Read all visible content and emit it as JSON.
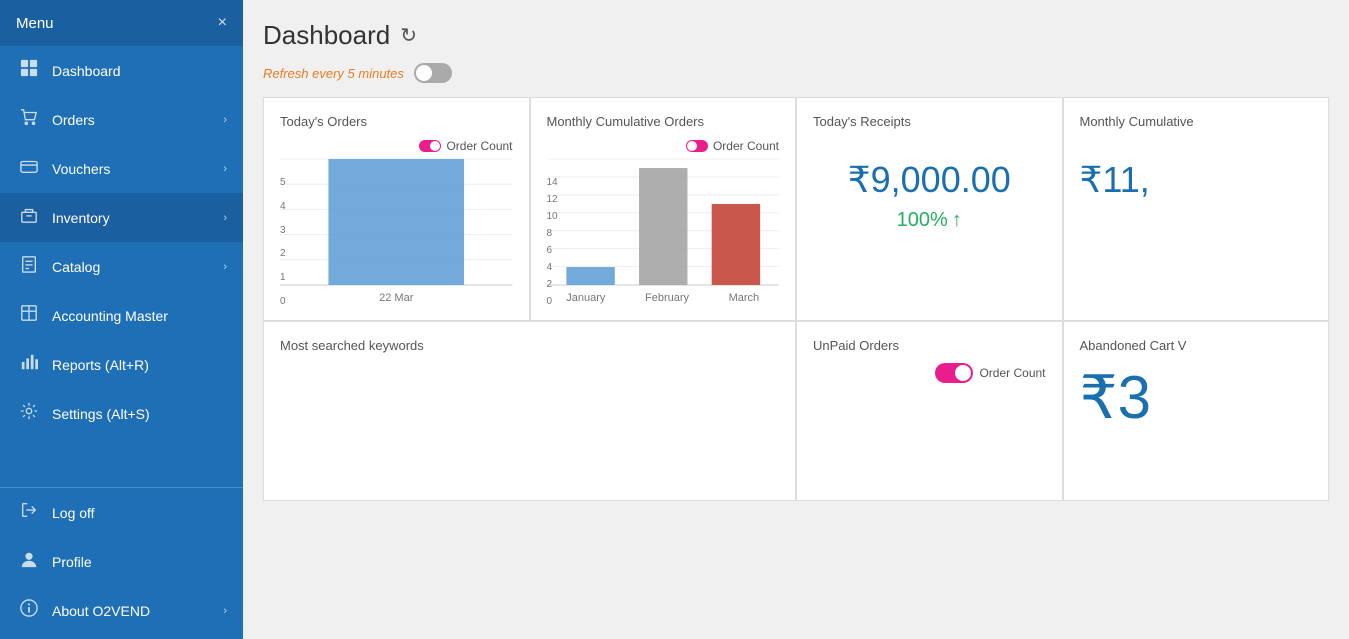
{
  "sidebar": {
    "header": "Menu",
    "close_icon": "×",
    "items": [
      {
        "id": "dashboard",
        "label": "Dashboard",
        "icon": "⊞",
        "has_arrow": false,
        "active": false
      },
      {
        "id": "orders",
        "label": "Orders",
        "icon": "🛒",
        "has_arrow": true,
        "active": false
      },
      {
        "id": "vouchers",
        "label": "Vouchers",
        "icon": "🏷",
        "has_arrow": true,
        "active": false
      },
      {
        "id": "inventory",
        "label": "Inventory",
        "icon": "📦",
        "has_arrow": true,
        "active": true
      },
      {
        "id": "catalog",
        "label": "Catalog",
        "icon": "📋",
        "has_arrow": true,
        "active": false
      },
      {
        "id": "accounting",
        "label": "Accounting Master",
        "icon": "📊",
        "has_arrow": false,
        "active": false
      },
      {
        "id": "reports",
        "label": "Reports (Alt+R)",
        "icon": "📈",
        "has_arrow": false,
        "active": false
      },
      {
        "id": "settings",
        "label": "Settings (Alt+S)",
        "icon": "⚙",
        "has_arrow": false,
        "active": false
      }
    ],
    "bottom_items": [
      {
        "id": "logoff",
        "label": "Log off",
        "icon": "↩",
        "has_arrow": false
      },
      {
        "id": "profile",
        "label": "Profile",
        "icon": "👤",
        "has_arrow": false
      },
      {
        "id": "about",
        "label": "About O2VEND",
        "icon": "ℹ",
        "has_arrow": true
      }
    ]
  },
  "page": {
    "title": "Dashboard",
    "refresh_label": "Refresh every 5 minutes",
    "refresh_icon": "↻"
  },
  "cards": {
    "todays_orders": {
      "title": "Today's Orders",
      "legend": "Order Count",
      "x_label": "22 Mar",
      "bar_value": 5,
      "y_max": 5,
      "y_labels": [
        "5",
        "4",
        "3",
        "2",
        "1",
        "0"
      ]
    },
    "monthly_cumulative": {
      "title": "Monthly Cumulative Orders",
      "legend": "Order Count",
      "bars": [
        {
          "label": "January",
          "value": 2,
          "color": "#5b9bd5"
        },
        {
          "label": "February",
          "value": 13,
          "color": "#a0a0a0"
        },
        {
          "label": "March",
          "value": 9,
          "color": "#c0392b"
        }
      ],
      "y_labels": [
        "14",
        "12",
        "10",
        "8",
        "6",
        "4",
        "2",
        "0"
      ]
    },
    "todays_receipts": {
      "title": "Today's Receipts",
      "amount": "₹9,000.00",
      "percent": "100%",
      "arrow": "↑"
    },
    "monthly_cumulative_receipts": {
      "title": "Monthly Cumulative",
      "amount": "₹11,"
    },
    "most_searched": {
      "title": "Most searched keywords"
    },
    "unpaid_orders": {
      "title": "UnPaid Orders",
      "legend": "Order Count"
    },
    "abandoned_cart": {
      "title": "Abandoned Cart V",
      "amount": "₹3"
    }
  }
}
